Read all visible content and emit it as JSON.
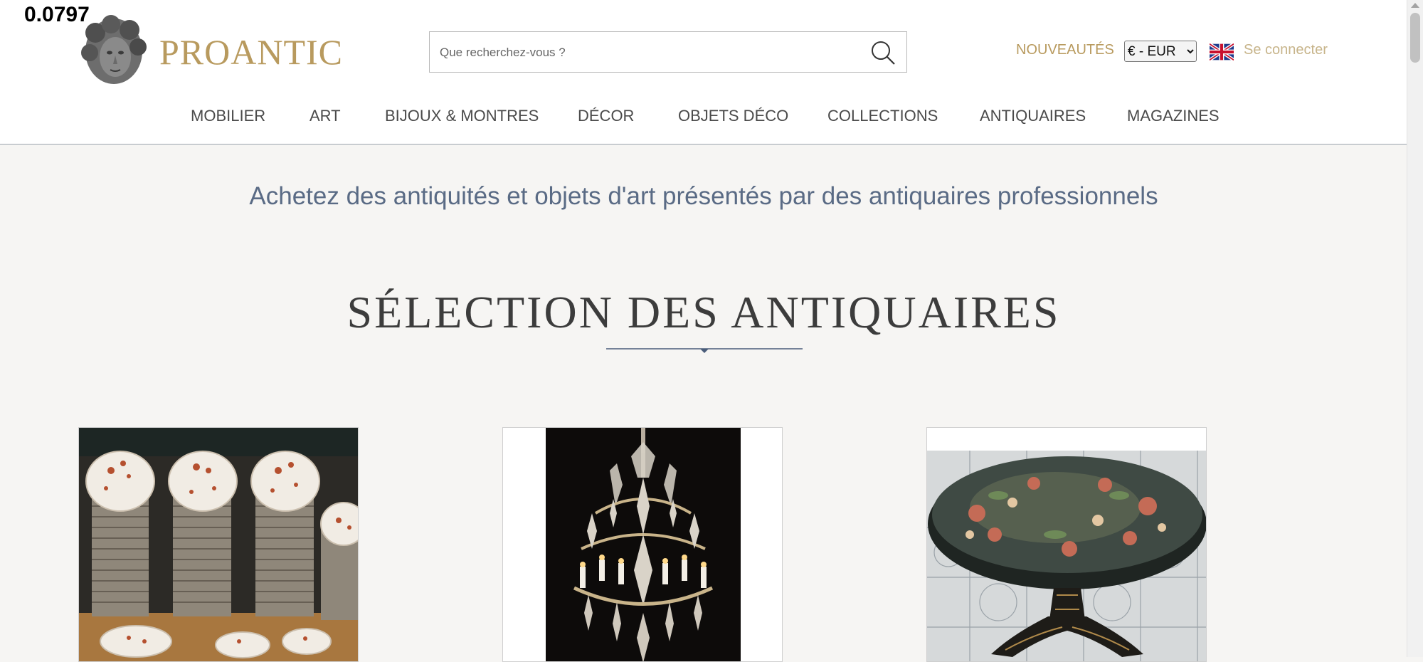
{
  "overlay_value": "0.0797",
  "header": {
    "logo_text": "PROANTIC",
    "search_placeholder": "Que recherchez-vous ?",
    "new_label": "NOUVEAUTÉS",
    "currency_selected": "€ - EUR",
    "language_flag": "uk-flag-icon",
    "login_label": "Se connecter"
  },
  "nav": {
    "items": [
      "MOBILIER",
      "ART",
      "BIJOUX & MONTRES",
      "DÉCOR",
      "OBJETS DÉCO",
      "COLLECTIONS",
      "ANTIQUAIRES",
      "MAGAZINES"
    ]
  },
  "main": {
    "tagline": "Achetez des antiquités et objets d'art présentés par des antiquaires professionnels",
    "section_title": "SÉLECTION DES ANTIQUAIRES"
  },
  "colors": {
    "brand_gold": "#b89a5e",
    "tagline_blue": "#5a6b85",
    "background": "#f6f5f3"
  }
}
